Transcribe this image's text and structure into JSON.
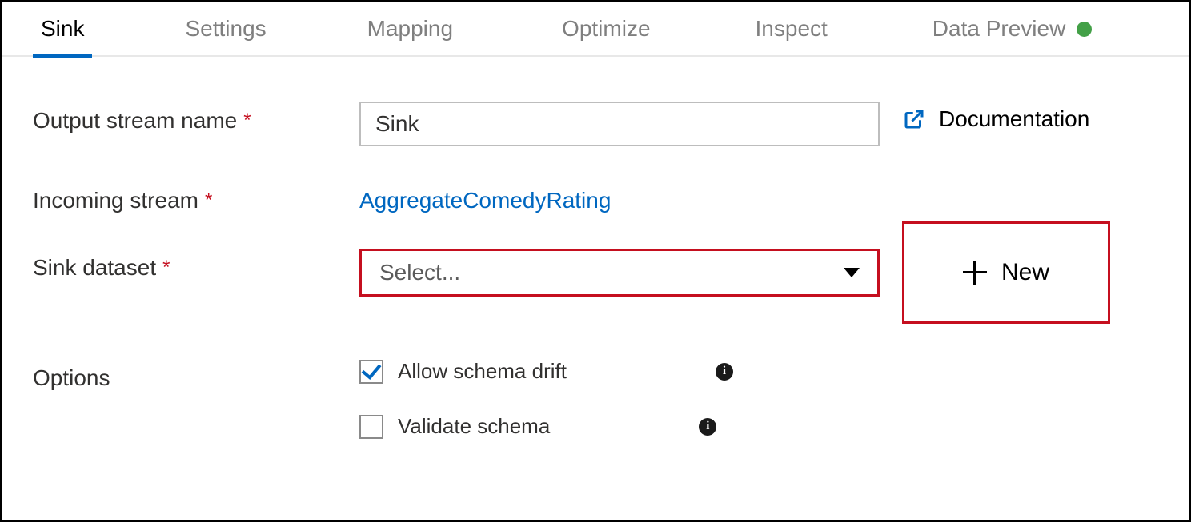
{
  "tabs": {
    "sink": "Sink",
    "settings": "Settings",
    "mapping": "Mapping",
    "optimize": "Optimize",
    "inspect": "Inspect",
    "data_preview": "Data Preview"
  },
  "form": {
    "output_stream_name": {
      "label": "Output stream name",
      "value": "Sink"
    },
    "incoming_stream": {
      "label": "Incoming stream",
      "value": "AggregateComedyRating"
    },
    "sink_dataset": {
      "label": "Sink dataset",
      "placeholder": "Select..."
    },
    "options_label": "Options",
    "allow_schema_drift": {
      "label": "Allow schema drift",
      "checked": true
    },
    "validate_schema": {
      "label": "Validate schema",
      "checked": false
    }
  },
  "side": {
    "documentation": "Documentation",
    "new_button": "New"
  }
}
